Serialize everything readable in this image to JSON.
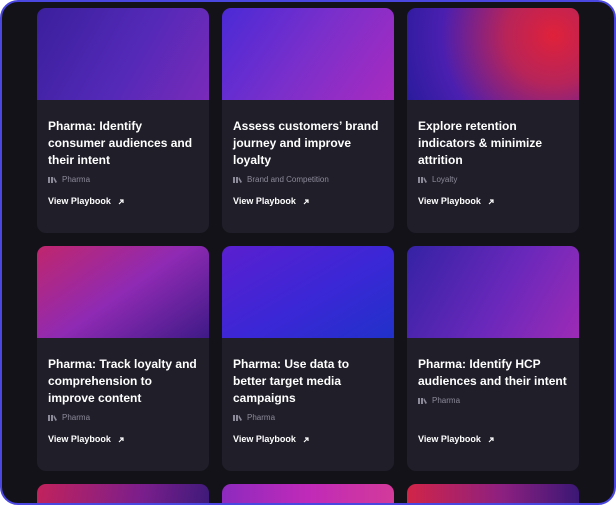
{
  "cards": [
    {
      "title": "Pharma: Identify consumer audiences and their intent",
      "tag": "Pharma",
      "cta": "View Playbook"
    },
    {
      "title": "Assess customers’ brand journey and improve loyalty",
      "tag": "Brand and Competition",
      "cta": "View Playbook"
    },
    {
      "title": "Explore retention indicators & minimize attrition",
      "tag": "Loyalty",
      "cta": "View Playbook"
    },
    {
      "title": "Pharma: Track loyalty and comprehension to improve content",
      "tag": "Pharma",
      "cta": "View Playbook"
    },
    {
      "title": "Pharma: Use data to better target media campaigns",
      "tag": "Pharma",
      "cta": "View Playbook"
    },
    {
      "title": "Pharma: Identify HCP audiences and their intent",
      "tag": "Pharma",
      "cta": "View Playbook"
    }
  ],
  "colors": {
    "background": "#141219",
    "card": "#201e29",
    "frame_border": "#4a47e0",
    "tag_text": "#8d8a99"
  },
  "icons": {
    "tag": "category-tag-icon",
    "cta": "arrow-up-right-icon"
  }
}
